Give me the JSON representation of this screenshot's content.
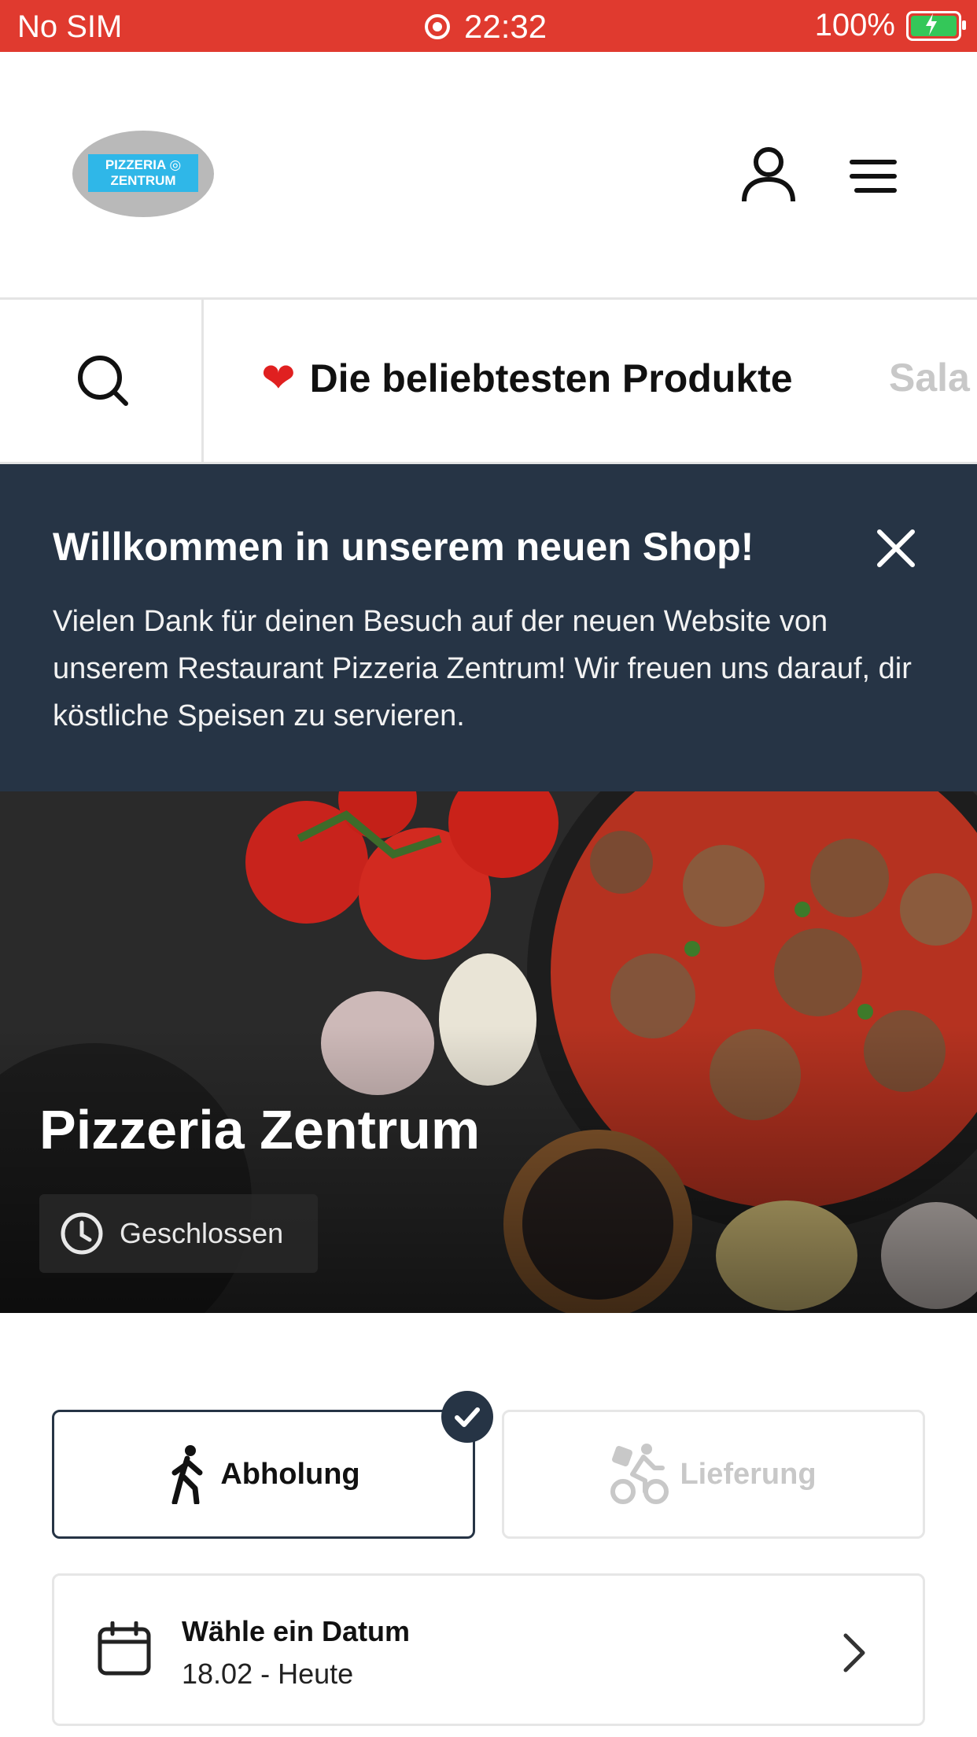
{
  "status_bar": {
    "carrier": "No SIM",
    "time": "22:32",
    "battery": "100%"
  },
  "header": {
    "logo_text": "PIZZERIA ZENTRUM",
    "icons": [
      "user-icon",
      "menu-icon"
    ]
  },
  "categories": {
    "active": "Die beliebtesten Produkte",
    "active_icon": "heart-icon",
    "next": "Sala"
  },
  "welcome": {
    "title": "Willkommen in unserem neuen Shop!",
    "body": "Vielen Dank für deinen Besuch auf der neuen Website von unserem Restaurant Pizzeria Zentrum! Wir freuen uns darauf, dir köstliche Speisen zu servieren."
  },
  "hero": {
    "name": "Pizzeria Zentrum",
    "status": "Geschlossen"
  },
  "order_type": {
    "pickup": "Abholung",
    "delivery": "Lieferung",
    "selected": "pickup"
  },
  "date_picker": {
    "title": "Wähle ein Datum",
    "value": "18.02 - Heute"
  },
  "colors": {
    "status_bar": "#e03a2f",
    "banner": "#263445",
    "accent": "#263445"
  }
}
